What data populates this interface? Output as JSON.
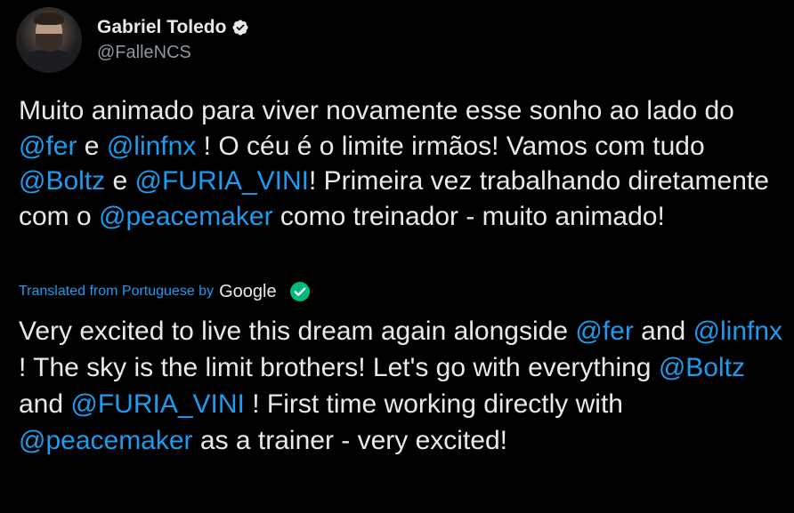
{
  "author": {
    "display_name": "Gabriel Toledo",
    "handle": "@FalleNCS",
    "verified": true
  },
  "original": {
    "segments": [
      {
        "text": "Muito animado para viver novamente esse sonho ao lado do ",
        "mention": false
      },
      {
        "text": "@fer",
        "mention": true
      },
      {
        "text": " e ",
        "mention": false
      },
      {
        "text": "@linfnx",
        "mention": true
      },
      {
        "text": " ! O céu é o limite irmãos! Vamos com tudo ",
        "mention": false
      },
      {
        "text": "@Boltz",
        "mention": true
      },
      {
        "text": " e ",
        "mention": false
      },
      {
        "text": "@FURIA_VINI",
        "mention": true
      },
      {
        "text": "! Primeira vez trabalhando diretamente com o ",
        "mention": false
      },
      {
        "text": "@peacemaker",
        "mention": true
      },
      {
        "text": " como treinador - muito animado!",
        "mention": false
      }
    ]
  },
  "translation_bar": {
    "label": "Translated from Portuguese by",
    "provider": "Google"
  },
  "translation": {
    "segments": [
      {
        "text": "Very excited to live this dream again alongside ",
        "mention": false
      },
      {
        "text": "@fer",
        "mention": true
      },
      {
        "text": " and ",
        "mention": false
      },
      {
        "text": "@linfnx",
        "mention": true
      },
      {
        "text": " ! The sky is the limit brothers! Let's go with everything ",
        "mention": false
      },
      {
        "text": "@Boltz",
        "mention": true
      },
      {
        "text": " and ",
        "mention": false
      },
      {
        "text": "@FURIA_VINI",
        "mention": true
      },
      {
        "text": " ! First time working directly with ",
        "mention": false
      },
      {
        "text": "@peacemaker",
        "mention": true
      },
      {
        "text": " as a trainer - very excited!",
        "mention": false
      }
    ]
  },
  "icons": {
    "verified": "verified-badge-icon",
    "translate_check": "check-circle-icon"
  },
  "colors": {
    "background": "#000000",
    "text": "#e7e9ea",
    "secondary": "#8b98a5",
    "link": "#1d9bf0",
    "check": "#00ba7c"
  }
}
